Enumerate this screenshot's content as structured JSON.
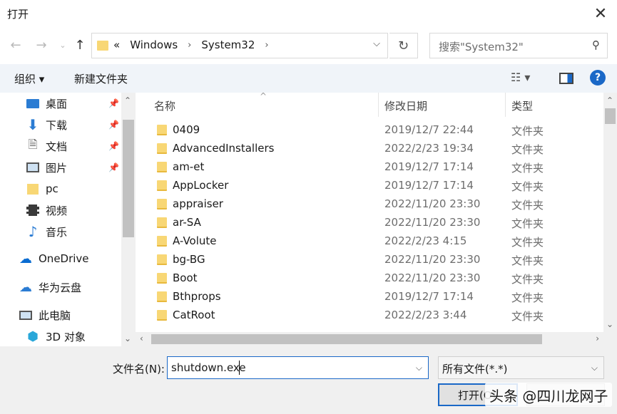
{
  "window": {
    "title": "打开",
    "close_glyph": "✕"
  },
  "address": {
    "overflow": "«",
    "crumbs": [
      "Windows",
      "System32"
    ]
  },
  "search": {
    "placeholder": "搜索\"System32\""
  },
  "toolbar": {
    "organize": "组织",
    "new_folder": "新建文件夹",
    "help": "?"
  },
  "nav": [
    {
      "label": "桌面",
      "icon": "desktop-icon",
      "pinned": true
    },
    {
      "label": "下载",
      "icon": "download-icon",
      "pinned": true
    },
    {
      "label": "文档",
      "icon": "document-icon",
      "pinned": true
    },
    {
      "label": "图片",
      "icon": "picture-icon",
      "pinned": true
    },
    {
      "label": "pc",
      "icon": "folder-icon",
      "pinned": false
    },
    {
      "label": "视频",
      "icon": "video-icon",
      "pinned": false
    },
    {
      "label": "音乐",
      "icon": "music-icon",
      "pinned": false
    },
    {
      "label": "OneDrive",
      "icon": "cloud-icon",
      "pinned": false
    },
    {
      "label": "华为云盘",
      "icon": "cloud-icon",
      "pinned": false
    },
    {
      "label": "此电脑",
      "icon": "computer-icon",
      "pinned": false
    },
    {
      "label": "3D 对象",
      "icon": "cube-icon",
      "pinned": false
    }
  ],
  "columns": {
    "name": "名称",
    "date": "修改日期",
    "type": "类型"
  },
  "files": [
    {
      "name": "0409",
      "date": "2019/12/7 22:44",
      "type": "文件夹"
    },
    {
      "name": "AdvancedInstallers",
      "date": "2022/2/23 19:34",
      "type": "文件夹"
    },
    {
      "name": "am-et",
      "date": "2019/12/7 17:14",
      "type": "文件夹"
    },
    {
      "name": "AppLocker",
      "date": "2019/12/7 17:14",
      "type": "文件夹"
    },
    {
      "name": "appraiser",
      "date": "2022/11/20 23:30",
      "type": "文件夹"
    },
    {
      "name": "ar-SA",
      "date": "2022/11/20 23:30",
      "type": "文件夹"
    },
    {
      "name": "A-Volute",
      "date": "2022/2/23 4:15",
      "type": "文件夹"
    },
    {
      "name": "bg-BG",
      "date": "2022/11/20 23:30",
      "type": "文件夹"
    },
    {
      "name": "Boot",
      "date": "2022/11/20 23:30",
      "type": "文件夹"
    },
    {
      "name": "Bthprops",
      "date": "2019/12/7 17:14",
      "type": "文件夹"
    },
    {
      "name": "CatRoot",
      "date": "2022/2/23 3:44",
      "type": "文件夹"
    }
  ],
  "footer": {
    "filename_label": "文件名(N):",
    "filename_value": "shutdown.exe",
    "filter_value": "所有文件(*.*)",
    "open_label": "打开(O)",
    "watermark": "头条 @四川龙网子"
  }
}
